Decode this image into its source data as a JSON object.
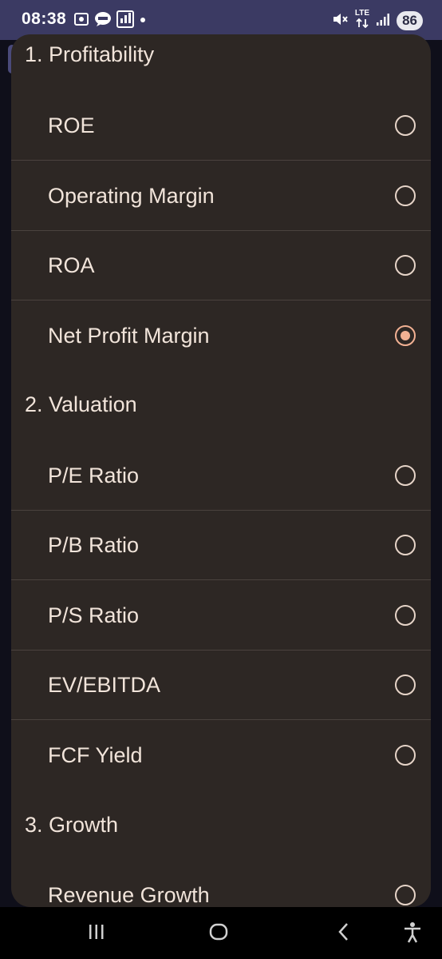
{
  "status_bar": {
    "time": "08:38",
    "battery": "86",
    "left_icons": [
      "screenshot-icon",
      "talk-icon",
      "voip-icon",
      "dot-icon"
    ],
    "right_icons": [
      "mute-icon",
      "lte-icon",
      "signal-icon"
    ],
    "lte_text": "LTE"
  },
  "sheet": {
    "sections": [
      {
        "title": "1. Profitability",
        "options": [
          {
            "label": "ROE",
            "selected": false
          },
          {
            "label": "Operating Margin",
            "selected": false
          },
          {
            "label": "ROA",
            "selected": false
          },
          {
            "label": "Net Profit Margin",
            "selected": true
          }
        ]
      },
      {
        "title": "2. Valuation",
        "options": [
          {
            "label": "P/E Ratio",
            "selected": false
          },
          {
            "label": "P/B Ratio",
            "selected": false
          },
          {
            "label": "P/S Ratio",
            "selected": false
          },
          {
            "label": "EV/EBITDA",
            "selected": false
          },
          {
            "label": "FCF Yield",
            "selected": false
          }
        ]
      },
      {
        "title": "3. Growth",
        "options": [
          {
            "label": "Revenue Growth",
            "selected": false
          }
        ]
      }
    ]
  },
  "nav_bar": {
    "buttons": [
      "recent-apps-icon",
      "home-icon",
      "back-icon",
      "accessibility-icon"
    ]
  },
  "colors": {
    "sheet_bg": "#2d2724",
    "text": "#f1e4da",
    "radio_selected": "#f2b193",
    "status_bar_bg": "#3b3a63"
  }
}
